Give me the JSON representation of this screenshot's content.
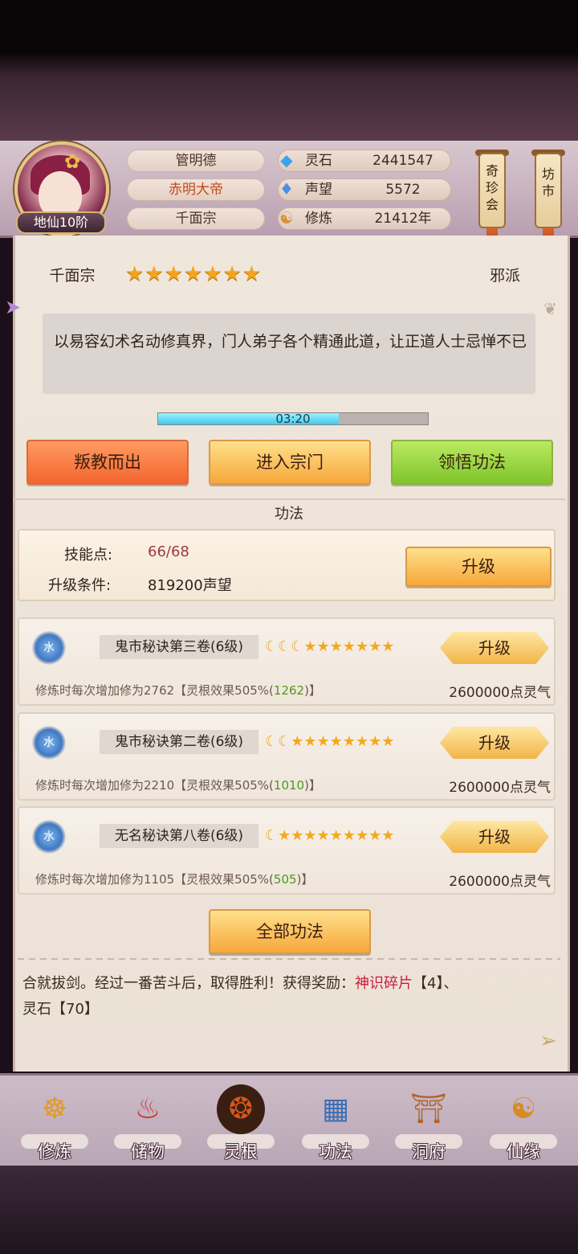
{
  "player": {
    "rank": "地仙10阶",
    "name": "管明德",
    "title": "赤明大帝",
    "sect": "千面宗"
  },
  "stats": [
    {
      "label": "灵石",
      "value": "2441547",
      "icon": "spirit-stone-icon"
    },
    {
      "label": "声望",
      "value": "5572",
      "icon": "reputation-icon"
    },
    {
      "label": "修炼",
      "value": "21412年",
      "icon": "meditation-icon"
    }
  ],
  "side_buttons": {
    "treasure": "奇珍会",
    "market": "坊市"
  },
  "sect_panel": {
    "name": "千面宗",
    "stars": "★★★★★★★",
    "alignment": "邪派",
    "description": "以易容幻术名动修真界，门人弟子各个精通此道，让正道人士忌惮不已",
    "timer": "03:20",
    "timer_progress": 0.67,
    "buttons": {
      "betray": "叛教而出",
      "enter": "进入宗门",
      "comprehend": "领悟功法"
    }
  },
  "techniques": {
    "section_title": "功法",
    "skill_points_label": "技能点:",
    "skill_points_value": "66/68",
    "upgrade_cond_label": "升级条件:",
    "upgrade_cond_value": "819200声望",
    "upgrade_label": "升级",
    "items": [
      {
        "element": "水",
        "name": "鬼市秘诀第三卷(6级)",
        "stars": "☾☾☾★★★★★★★",
        "desc_prefix": "修炼时每次增加修为2762【灵根效果505%(",
        "desc_green": "1262",
        "desc_suffix": ")】",
        "cost": "2600000点灵气",
        "button": "升级"
      },
      {
        "element": "水",
        "name": "鬼市秘诀第二卷(6级)",
        "stars": "☾☾★★★★★★★★",
        "desc_prefix": "修炼时每次增加修为2210【灵根效果505%(",
        "desc_green": "1010",
        "desc_suffix": ")】",
        "cost": "2600000点灵气",
        "button": "升级"
      },
      {
        "element": "水",
        "name": "无名秘诀第八卷(6级)",
        "stars": "☾★★★★★★★★★",
        "desc_prefix": "修炼时每次增加修为1105【灵根效果505%(",
        "desc_green": "505",
        "desc_suffix": ")】",
        "cost": "2600000点灵气",
        "button": "升级"
      }
    ],
    "all_button": "全部功法"
  },
  "message": {
    "prefix": "合就拔剑。经过一番苦斗后，取得胜利！获得奖励：",
    "reward1": "神识碎片",
    "reward1_qty": "【4】、",
    "reward2": "灵石【70】"
  },
  "nav": [
    {
      "label": "修炼",
      "icon": "cultivate-icon"
    },
    {
      "label": "储物",
      "icon": "storage-bag-icon"
    },
    {
      "label": "灵根",
      "icon": "spirit-root-icon"
    },
    {
      "label": "功法",
      "icon": "technique-book-icon"
    },
    {
      "label": "洞府",
      "icon": "cave-dwelling-icon"
    },
    {
      "label": "仙缘",
      "icon": "immortal-fate-icon"
    }
  ]
}
